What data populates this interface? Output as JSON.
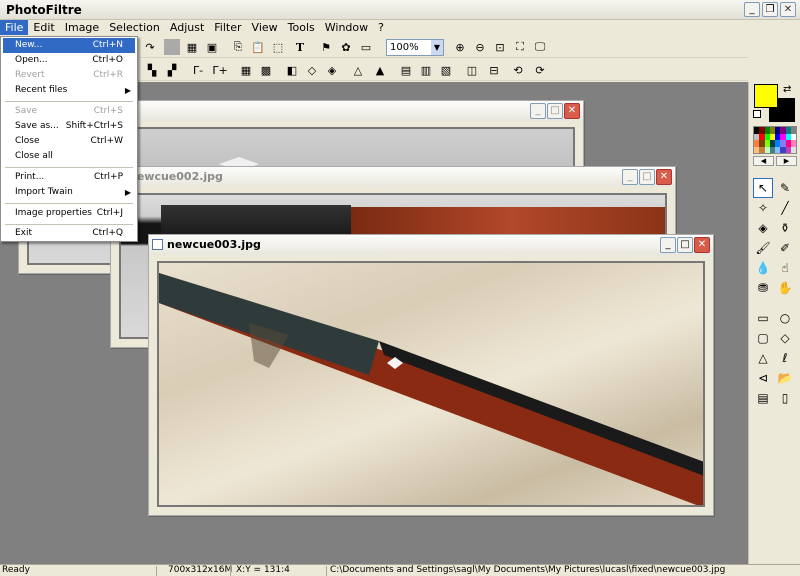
{
  "app": {
    "title": "PhotoFiltre"
  },
  "menubar": [
    "File",
    "Edit",
    "Image",
    "Selection",
    "Adjust",
    "Filter",
    "View",
    "Tools",
    "Window",
    "?"
  ],
  "zoom": {
    "value": "100%"
  },
  "file_menu": {
    "items": [
      {
        "label": "New...",
        "shortcut": "Ctrl+N",
        "state": "highlighted"
      },
      {
        "label": "Open...",
        "shortcut": "Ctrl+O",
        "state": "normal"
      },
      {
        "label": "Revert",
        "shortcut": "Ctrl+R",
        "state": "disabled"
      },
      {
        "label": "Recent files",
        "shortcut": "",
        "state": "submenu"
      },
      {
        "label": "Save",
        "shortcut": "Ctrl+S",
        "state": "disabled"
      },
      {
        "label": "Save as...",
        "shortcut": "Shift+Ctrl+S",
        "state": "normal"
      },
      {
        "label": "Close",
        "shortcut": "Ctrl+W",
        "state": "normal"
      },
      {
        "label": "Close all",
        "shortcut": "",
        "state": "normal"
      },
      {
        "label": "Print...",
        "shortcut": "Ctrl+P",
        "state": "normal"
      },
      {
        "label": "Import Twain",
        "shortcut": "",
        "state": "submenu"
      },
      {
        "label": "Image properties",
        "shortcut": "Ctrl+J",
        "state": "normal"
      },
      {
        "label": "Exit",
        "shortcut": "Ctrl+Q",
        "state": "normal"
      }
    ]
  },
  "windows": {
    "win2": {
      "title": "newcue002.jpg"
    },
    "win3": {
      "title": "newcue003.jpg"
    }
  },
  "palette": {
    "foreground": "#ffff00",
    "background": "#000000"
  },
  "statusbar": {
    "state": "Ready",
    "size": "700x312x16M",
    "coords": "X:Y = 131:4",
    "path": "C:\\Documents and Settings\\sagl\\My Documents\\My Pictures\\lucasl\\fixed\\newcue003.jpg"
  }
}
